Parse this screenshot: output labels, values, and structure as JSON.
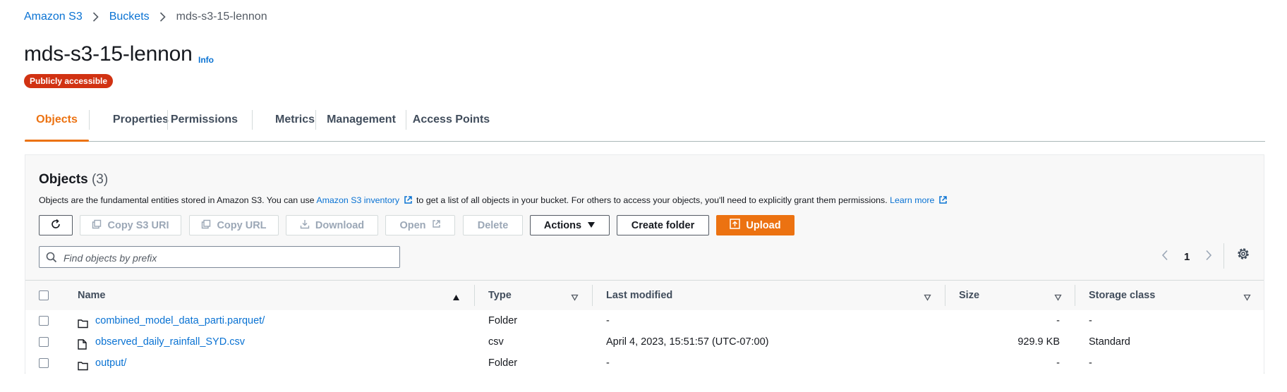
{
  "breadcrumb": {
    "items": [
      "Amazon S3",
      "Buckets",
      "mds-s3-15-lennon"
    ]
  },
  "header": {
    "title": "mds-s3-15-lennon",
    "info": "Info",
    "badge": "Publicly accessible"
  },
  "tabs": [
    "Objects",
    "Properties",
    "Permissions",
    "Metrics",
    "Management",
    "Access Points"
  ],
  "panel": {
    "title": "Objects",
    "count": "(3)",
    "desc_1": "Objects are the fundamental entities stored in Amazon S3. You can use ",
    "desc_link_1": "Amazon S3 inventory",
    "desc_2": " to get a list of all objects in your bucket. For others to access your objects, you'll need to explicitly grant them permissions. ",
    "desc_link_2": "Learn more"
  },
  "toolbar": {
    "copy_s3_uri": "Copy S3 URI",
    "copy_url": "Copy URL",
    "download": "Download",
    "open": "Open",
    "delete": "Delete",
    "actions": "Actions",
    "create_folder": "Create folder",
    "upload": "Upload"
  },
  "search": {
    "placeholder": "Find objects by prefix"
  },
  "pagination": {
    "page": "1"
  },
  "table": {
    "columns": [
      "Name",
      "Type",
      "Last modified",
      "Size",
      "Storage class"
    ],
    "rows": [
      {
        "icon": "folder-icon",
        "name": "combined_model_data_parti.parquet/",
        "type": "Folder",
        "modified": "-",
        "size": "-",
        "storage": "-"
      },
      {
        "icon": "file-icon",
        "name": "observed_daily_rainfall_SYD.csv",
        "type": "csv",
        "modified": "April 4, 2023, 15:51:57 (UTC-07:00)",
        "size": "929.9 KB",
        "storage": "Standard"
      },
      {
        "icon": "folder-icon",
        "name": "output/",
        "type": "Folder",
        "modified": "-",
        "size": "-",
        "storage": "-"
      }
    ]
  },
  "colors": {
    "accent": "#ec7211",
    "link": "#0972d3",
    "badge": "#d13212"
  }
}
